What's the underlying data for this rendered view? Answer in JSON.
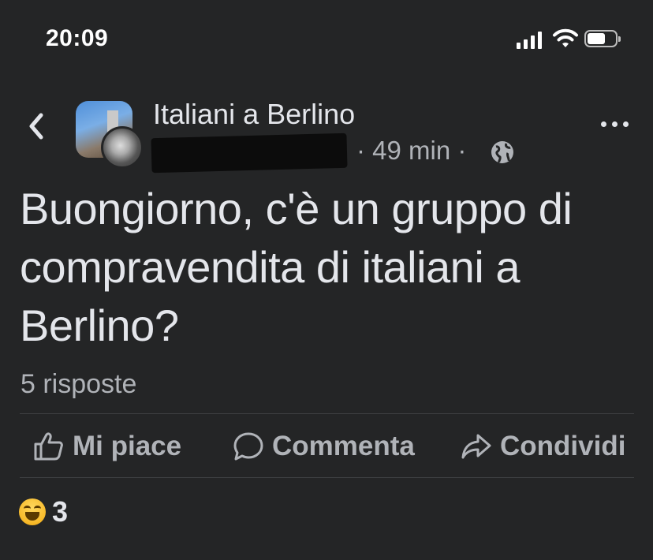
{
  "status_bar": {
    "time": "20:09"
  },
  "header": {
    "group_name": "Italiani a Berlino",
    "post_time": "· 49 min ·",
    "icons": {
      "back": "chevron-left-icon",
      "privacy": "globe-icon",
      "more": "more-options-icon"
    }
  },
  "post": {
    "text": "Buongiorno, c'è un gruppo di compravendita di italiani a Berlino?",
    "replies_label": "5 risposte"
  },
  "actions": {
    "like_label": "Mi piace",
    "comment_label": "Commenta",
    "share_label": "Condividi"
  },
  "reactions": {
    "emoji": "haha-reaction-icon",
    "count": "3"
  },
  "colors": {
    "background": "#242526",
    "text": "#e4e6eb",
    "secondary": "#b0b3b8",
    "divider": "#3e4042"
  }
}
